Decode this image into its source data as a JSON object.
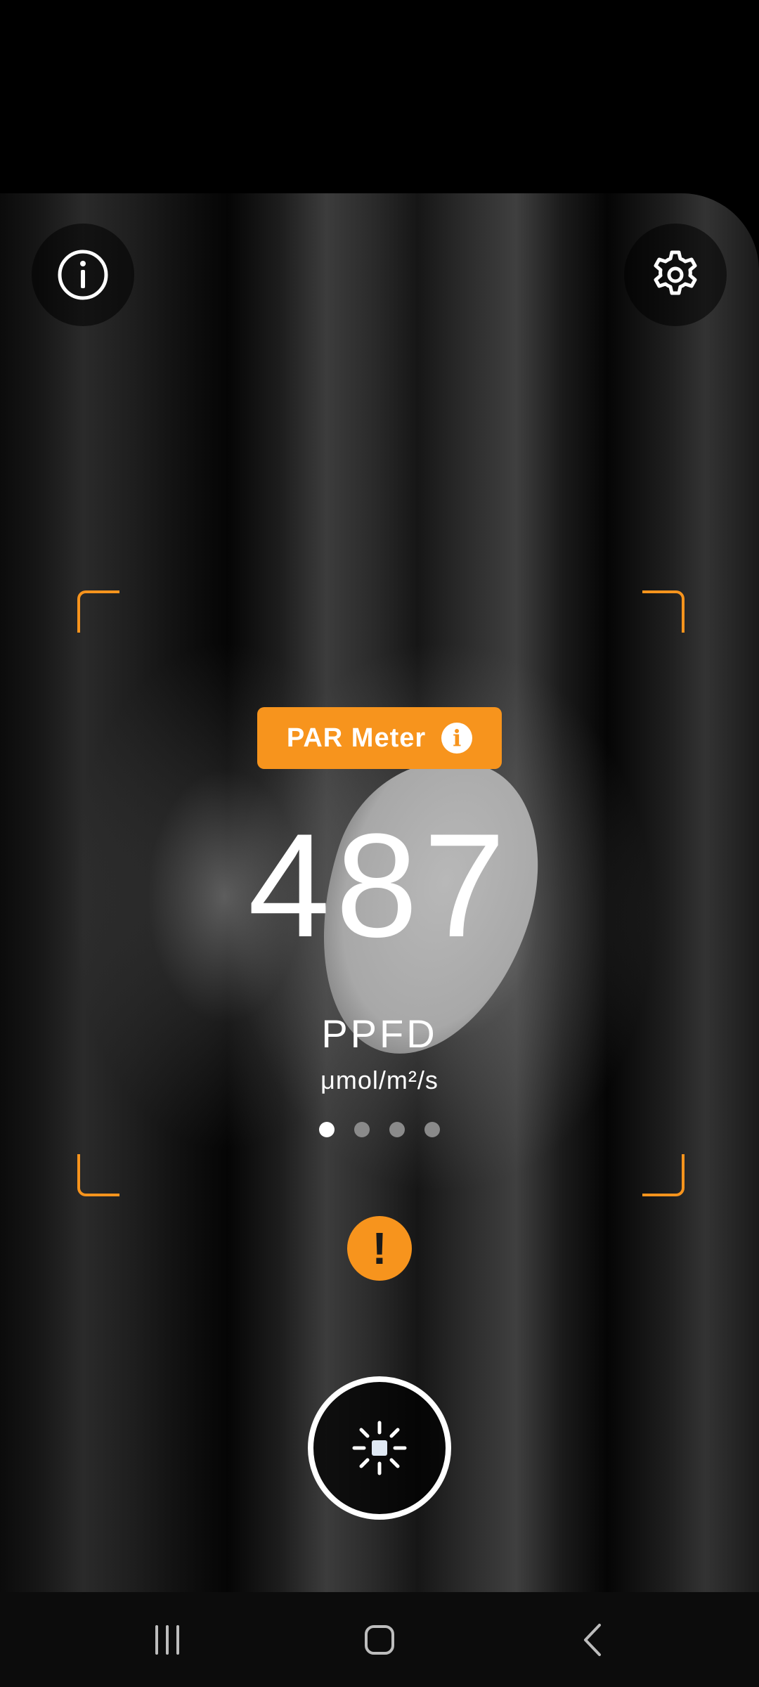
{
  "app": {
    "mode_badge": {
      "label": "PAR Meter",
      "info_glyph": "i"
    },
    "reading": {
      "value": "487",
      "unit": "PPFD",
      "unit_detail": "μmol/m²/s"
    },
    "pager": {
      "page_count": 4,
      "active_index": 0
    },
    "warning": {
      "glyph": "!"
    },
    "icons": {
      "top_left": "info-icon",
      "top_right": "gear-icon",
      "capture": "light-sensor-icon"
    },
    "colors": {
      "accent": "#f7941d",
      "text": "#ffffff",
      "background": "#000000"
    }
  },
  "navigation_bar": {
    "buttons": [
      "recent-apps",
      "home",
      "back"
    ]
  }
}
